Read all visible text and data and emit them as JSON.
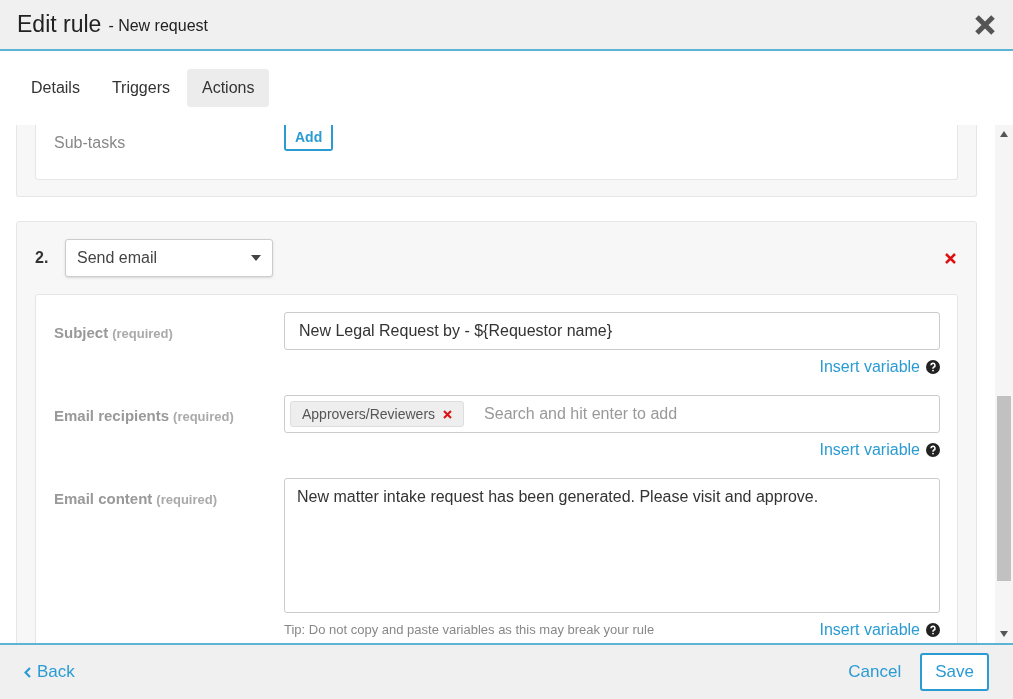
{
  "dialog": {
    "title": "Edit rule",
    "subtitle": "- New request"
  },
  "tabs": [
    {
      "label": "Details",
      "selected": false
    },
    {
      "label": "Triggers",
      "selected": false
    },
    {
      "label": "Actions",
      "selected": true
    }
  ],
  "subtasks": {
    "label": "Sub-tasks",
    "button": "Add"
  },
  "action": {
    "number": "2.",
    "type": "Send email",
    "fields": [
      {
        "kind": "text",
        "label": "Subject",
        "note": "(required)",
        "value": "New Legal Request by - ${Requestor name}",
        "link": "Insert variable"
      },
      {
        "kind": "tags",
        "label": "Email recipients",
        "note": "(required)",
        "tags": [
          "Approvers/Reviewers"
        ],
        "placeholder": "Search and hit enter to add",
        "link": "Insert variable"
      },
      {
        "kind": "textarea",
        "label": "Email content",
        "note": "(required)",
        "value": "New matter intake request has been generated. Please visit and approve.",
        "tip": "Tip: Do not copy and paste variables as this may break your rule",
        "link": "Insert variable"
      }
    ]
  },
  "footer": {
    "back": "Back",
    "cancel": "Cancel",
    "save": "Save"
  }
}
